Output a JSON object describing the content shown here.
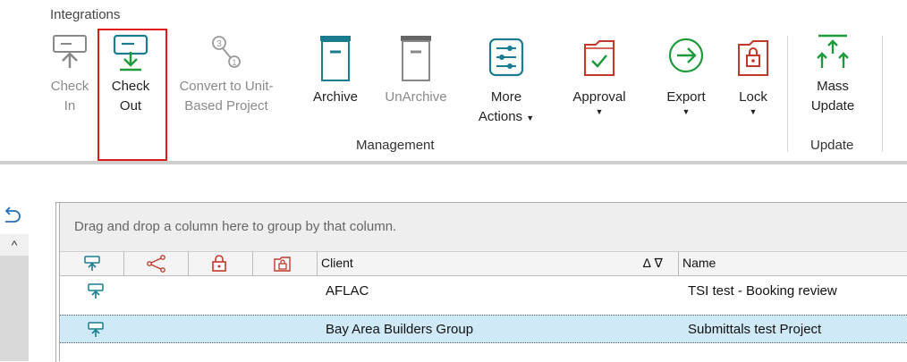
{
  "ribbon": {
    "tab_label": "Integrations",
    "buttons": {
      "check_in": {
        "line1": "Check",
        "line2": "In"
      },
      "check_out": {
        "line1": "Check",
        "line2": "Out"
      },
      "convert": {
        "line1": "Convert to Unit-",
        "line2": "Based Project"
      },
      "archive": {
        "line1": "Archive"
      },
      "unarchive": {
        "line1": "UnArchive"
      },
      "more_actions": {
        "line1": "More",
        "line2": "Actions"
      },
      "approval": {
        "line1": "Approval"
      },
      "export": {
        "line1": "Export"
      },
      "lock": {
        "line1": "Lock"
      },
      "mass_update": {
        "line1": "Mass",
        "line2": "Update"
      }
    },
    "groups": {
      "management": "Management",
      "update": "Update"
    }
  },
  "grid": {
    "groupby_hint": "Drag and drop a column here to group by that column.",
    "columns": {
      "client": "Client",
      "name": "Name",
      "sort_filter": "∆ ∇"
    },
    "rows": [
      {
        "client": "AFLAC",
        "name": "TSI test - Booking review",
        "selected": false
      },
      {
        "client": "Bay Area Builders Group",
        "name": "Submittals test Project",
        "selected": true
      }
    ]
  },
  "colors": {
    "accent_teal": "#1a7c8f",
    "green": "#1f9a3a",
    "red": "#c0392b",
    "highlight": "#e01b1b",
    "selected_row": "#cfe9f7"
  },
  "icons": {
    "check_in": "check-in-icon",
    "check_out": "check-out-icon",
    "convert": "convert-icon",
    "archive": "archive-box-icon",
    "unarchive": "unarchive-box-icon",
    "more_actions": "sliders-icon",
    "approval": "folder-check-icon",
    "export": "arrow-circle-icon",
    "lock": "folder-lock-icon",
    "mass_update": "multi-arrow-up-icon"
  }
}
